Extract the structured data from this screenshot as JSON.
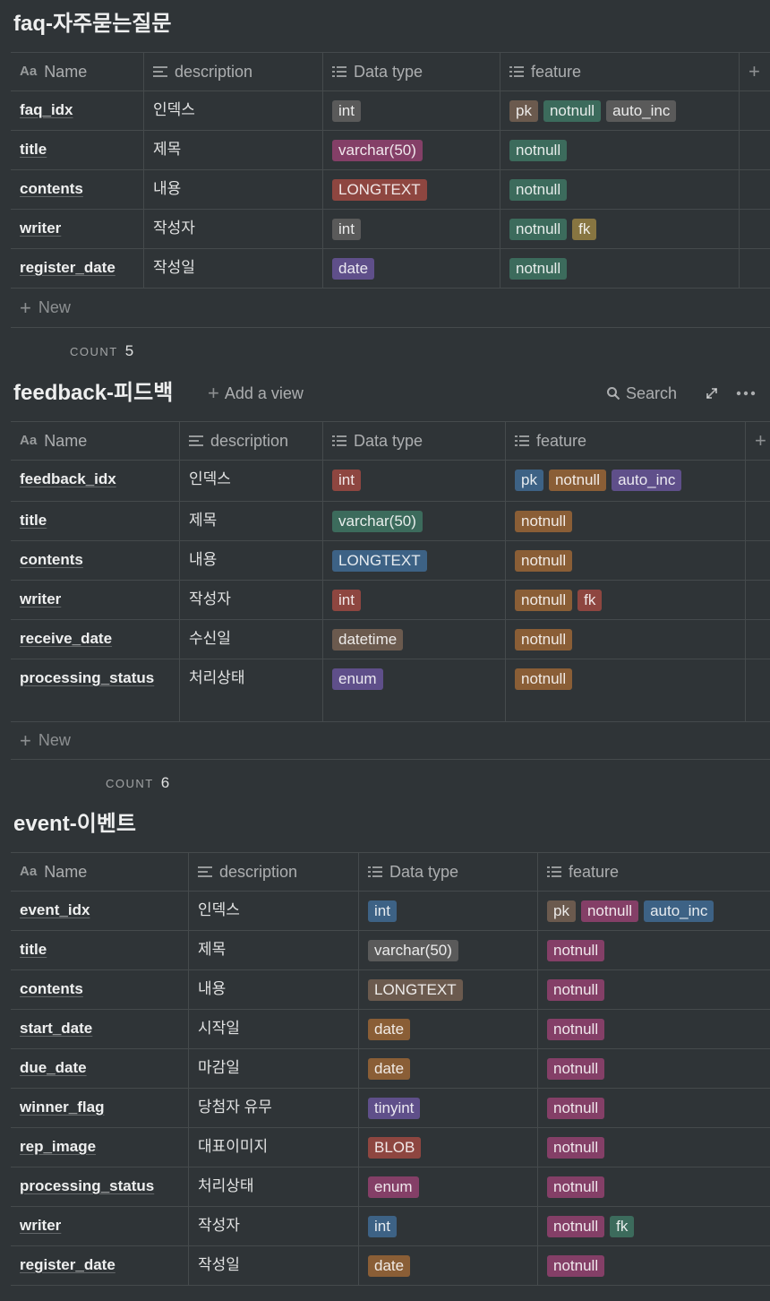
{
  "colors": {
    "gray": "#5a5a5a",
    "brown": "#6b5a4e",
    "orange": "#8a5e36",
    "yellow": "#877541",
    "green": "#3c6b5c",
    "blue": "#3d6285",
    "purple": "#5f4f8a",
    "pink": "#843f67",
    "red": "#8e4640"
  },
  "new_label": "New",
  "count_label": "COUNT",
  "toolbar": {
    "add_view": "Add a view",
    "search": "Search"
  },
  "columns": [
    "Name",
    "description",
    "Data type",
    "feature"
  ],
  "faq": {
    "title": "faq-자주묻는질문",
    "count": "5",
    "rows": [
      {
        "name": "faq_idx",
        "desc": "인덱스",
        "type": {
          "text": "int",
          "color": "gray"
        },
        "features": [
          {
            "text": "pk",
            "color": "brown"
          },
          {
            "text": "notnull",
            "color": "green"
          },
          {
            "text": "auto_inc",
            "color": "gray"
          }
        ]
      },
      {
        "name": "title",
        "desc": "제목",
        "type": {
          "text": "varchar(50)",
          "color": "pink"
        },
        "features": [
          {
            "text": "notnull",
            "color": "green"
          }
        ]
      },
      {
        "name": "contents",
        "desc": "내용",
        "type": {
          "text": "LONGTEXT",
          "color": "red"
        },
        "features": [
          {
            "text": "notnull",
            "color": "green"
          }
        ]
      },
      {
        "name": "writer",
        "desc": "작성자",
        "type": {
          "text": "int",
          "color": "gray"
        },
        "features": [
          {
            "text": "notnull",
            "color": "green"
          },
          {
            "text": "fk",
            "color": "yellow"
          }
        ]
      },
      {
        "name": "register_date",
        "desc": "작성일",
        "type": {
          "text": "date",
          "color": "purple"
        },
        "features": [
          {
            "text": "notnull",
            "color": "green"
          }
        ]
      }
    ]
  },
  "feedback": {
    "title": "feedback-피드백",
    "count": "6",
    "rows": [
      {
        "name": "feedback_idx",
        "desc": "인덱스",
        "type": {
          "text": "int",
          "color": "red"
        },
        "features": [
          {
            "text": "pk",
            "color": "blue"
          },
          {
            "text": "notnull",
            "color": "orange"
          },
          {
            "text": "auto_inc",
            "color": "purple"
          }
        ]
      },
      {
        "name": "title",
        "desc": "제목",
        "type": {
          "text": "varchar(50)",
          "color": "green"
        },
        "features": [
          {
            "text": "notnull",
            "color": "orange"
          }
        ]
      },
      {
        "name": "contents",
        "desc": "내용",
        "type": {
          "text": "LONGTEXT",
          "color": "blue"
        },
        "features": [
          {
            "text": "notnull",
            "color": "orange"
          }
        ]
      },
      {
        "name": "writer",
        "desc": "작성자",
        "type": {
          "text": "int",
          "color": "red"
        },
        "features": [
          {
            "text": "notnull",
            "color": "orange"
          },
          {
            "text": "fk",
            "color": "red"
          }
        ]
      },
      {
        "name": "receive_date",
        "desc": "수신일",
        "type": {
          "text": "datetime",
          "color": "brown"
        },
        "features": [
          {
            "text": "notnull",
            "color": "orange"
          }
        ]
      },
      {
        "name": "processing_status",
        "desc": "처리상태",
        "type": {
          "text": "enum",
          "color": "purple"
        },
        "features": [
          {
            "text": "notnull",
            "color": "orange"
          }
        ]
      }
    ]
  },
  "event": {
    "title": "event-이벤트",
    "rows": [
      {
        "name": "event_idx",
        "desc": "인덱스",
        "type": {
          "text": "int",
          "color": "blue"
        },
        "features": [
          {
            "text": "pk",
            "color": "brown"
          },
          {
            "text": "notnull",
            "color": "pink"
          },
          {
            "text": "auto_inc",
            "color": "blue"
          }
        ]
      },
      {
        "name": "title",
        "desc": "제목",
        "type": {
          "text": "varchar(50)",
          "color": "gray"
        },
        "features": [
          {
            "text": "notnull",
            "color": "pink"
          }
        ]
      },
      {
        "name": "contents",
        "desc": "내용",
        "type": {
          "text": "LONGTEXT",
          "color": "brown"
        },
        "features": [
          {
            "text": "notnull",
            "color": "pink"
          }
        ]
      },
      {
        "name": "start_date",
        "desc": "시작일",
        "type": {
          "text": "date",
          "color": "orange"
        },
        "features": [
          {
            "text": "notnull",
            "color": "pink"
          }
        ]
      },
      {
        "name": "due_date",
        "desc": "마감일",
        "type": {
          "text": "date",
          "color": "orange"
        },
        "features": [
          {
            "text": "notnull",
            "color": "pink"
          }
        ]
      },
      {
        "name": "winner_flag",
        "desc": "당첨자 유무",
        "type": {
          "text": "tinyint",
          "color": "purple"
        },
        "features": [
          {
            "text": "notnull",
            "color": "pink"
          }
        ]
      },
      {
        "name": "rep_image",
        "desc": "대표이미지",
        "type": {
          "text": "BLOB",
          "color": "red"
        },
        "features": [
          {
            "text": "notnull",
            "color": "pink"
          }
        ]
      },
      {
        "name": "processing_status",
        "desc": "처리상태",
        "type": {
          "text": "enum",
          "color": "pink"
        },
        "features": [
          {
            "text": "notnull",
            "color": "pink"
          }
        ]
      },
      {
        "name": "writer",
        "desc": "작성자",
        "type": {
          "text": "int",
          "color": "blue"
        },
        "features": [
          {
            "text": "notnull",
            "color": "pink"
          },
          {
            "text": "fk",
            "color": "green"
          }
        ]
      },
      {
        "name": "register_date",
        "desc": "작성일",
        "type": {
          "text": "date",
          "color": "orange"
        },
        "features": [
          {
            "text": "notnull",
            "color": "pink"
          }
        ]
      }
    ]
  }
}
